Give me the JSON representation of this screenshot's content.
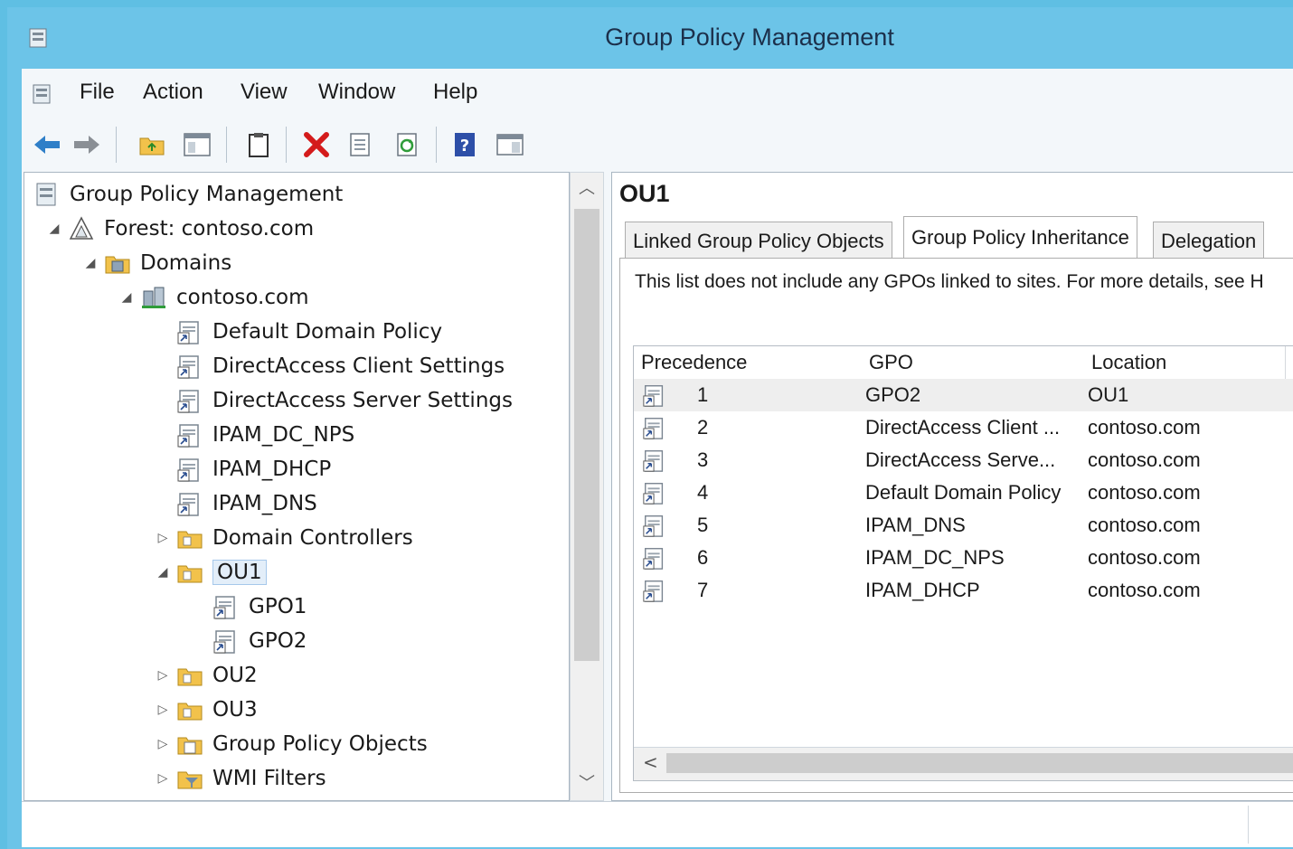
{
  "window": {
    "title": "Group Policy Management"
  },
  "menu": {
    "items": [
      "File",
      "Action",
      "View",
      "Window",
      "Help"
    ]
  },
  "toolbar": {
    "buttons": [
      "back-arrow-icon",
      "forward-arrow-icon",
      "up-folder-icon",
      "show-hide-console-tree-icon",
      "clipboard-icon",
      "delete-icon",
      "properties-icon",
      "refresh-icon",
      "help-icon",
      "action-pane-icon"
    ]
  },
  "tree": {
    "root": "Group Policy Management",
    "forest": "Forest: contoso.com",
    "domains": "Domains",
    "domain": "contoso.com",
    "links": [
      "Default Domain Policy",
      "DirectAccess Client Settings",
      "DirectAccess Server Settings",
      "IPAM_DC_NPS",
      "IPAM_DHCP",
      "IPAM_DNS"
    ],
    "dc": "Domain Controllers",
    "ou1": "OU1",
    "ou1_links": [
      "GPO1",
      "GPO2"
    ],
    "ou2": "OU2",
    "ou3": "OU3",
    "gpo_container": "Group Policy Objects",
    "wmi": "WMI Filters"
  },
  "right": {
    "title": "OU1",
    "tabs": [
      "Linked Group Policy Objects",
      "Group Policy Inheritance",
      "Delegation"
    ],
    "active_tab": "Group Policy Inheritance",
    "note": "This list does not include any GPOs linked to sites. For more details, see H",
    "columns": [
      "Precedence",
      "GPO",
      "Location"
    ],
    "rows": [
      {
        "precedence": "1",
        "gpo": "GPO2",
        "location": "OU1"
      },
      {
        "precedence": "2",
        "gpo": "DirectAccess Client ...",
        "location": "contoso.com"
      },
      {
        "precedence": "3",
        "gpo": "DirectAccess Serve...",
        "location": "contoso.com"
      },
      {
        "precedence": "4",
        "gpo": "Default Domain Policy",
        "location": "contoso.com"
      },
      {
        "precedence": "5",
        "gpo": "IPAM_DNS",
        "location": "contoso.com"
      },
      {
        "precedence": "6",
        "gpo": "IPAM_DC_NPS",
        "location": "contoso.com"
      },
      {
        "precedence": "7",
        "gpo": "IPAM_DHCP",
        "location": "contoso.com"
      }
    ]
  },
  "colors": {
    "accent": "#6cc4e8",
    "selection": "#e3eef9"
  }
}
